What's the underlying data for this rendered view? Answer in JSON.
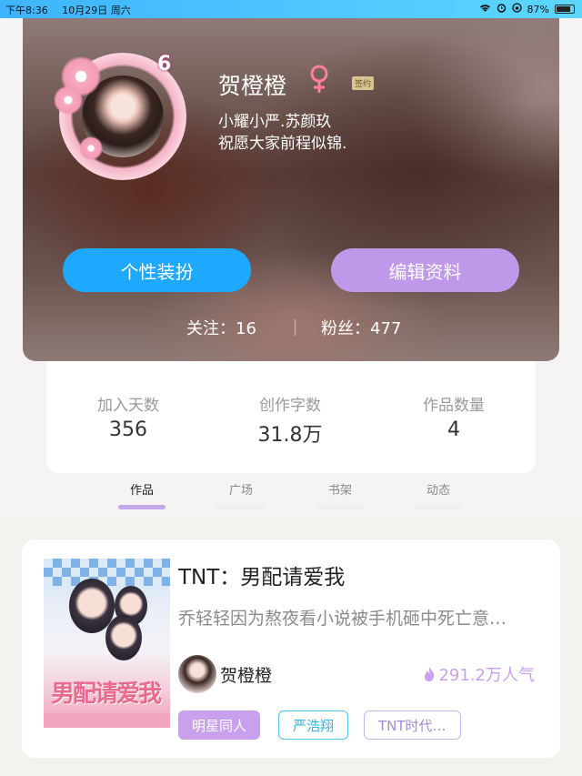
{
  "status_bar": {
    "time": "下午8:36",
    "date": "10月29日 周六",
    "battery": "87%"
  },
  "profile": {
    "level": "6",
    "name": "贺橙橙",
    "gender_symbol": "♀",
    "sign_badge": "签约",
    "bio_line1": "小耀小严.苏颜玖",
    "bio_line2": "祝愿大家前程似锦.",
    "dress_button": "个性装扮",
    "edit_button": "编辑资料",
    "following": "关注：16",
    "fans": "粉丝：477"
  },
  "stats": [
    {
      "label": "加入天数",
      "value": "356"
    },
    {
      "label": "创作字数",
      "value": "31.8万"
    },
    {
      "label": "作品数量",
      "value": "4"
    }
  ],
  "tabs": [
    {
      "label": "作品",
      "active": true
    },
    {
      "label": "广场",
      "active": false
    },
    {
      "label": "书架",
      "active": false
    },
    {
      "label": "动态",
      "active": false
    }
  ],
  "book": {
    "title": "TNT：男配请爱我",
    "description": "乔轻轻因为熬夜看小说被手机砸中死亡意…",
    "author": "贺橙橙",
    "popularity": "291.2万人气",
    "tags": [
      "明星同人",
      "严浩翔",
      "TNT时代…"
    ],
    "cover_art_text": "男配请爱我"
  },
  "colors": {
    "status_bar": "#3eb4ff",
    "dress_button": "#1ea9ff",
    "edit_button": "#bf98ea",
    "accent_purple": "#c9a0f0",
    "tag_blue": "#4cc6ea"
  }
}
